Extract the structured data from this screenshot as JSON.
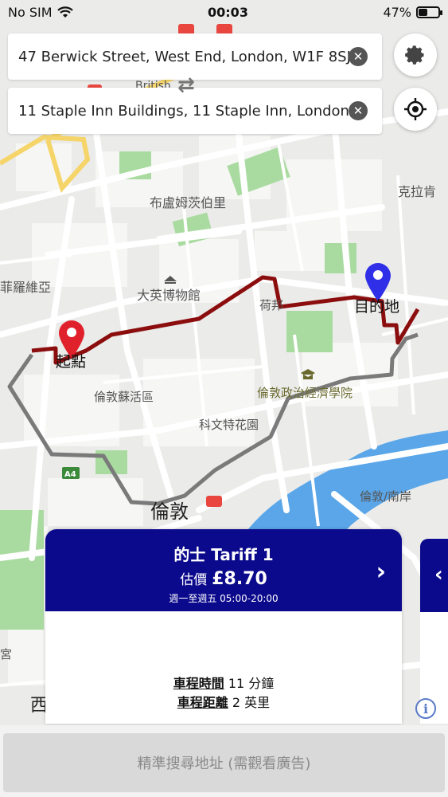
{
  "status_bar": {
    "carrier": "No SIM",
    "time": "00:03",
    "battery_percent": "47%",
    "battery_level": 0.47
  },
  "address": {
    "origin": "47 Berwick Street, West End, London, W1F 8SJ",
    "destination": "11 Staple Inn Buildings, 11 Staple Inn, London,"
  },
  "map": {
    "labels": {
      "british": "British",
      "bloomsbury": "布盧姆茨伯里",
      "clerkenwell": "克拉肯",
      "fitzrovia": "菲羅維亞",
      "museum": "大英博物館",
      "holborn": "荷邦",
      "start": "起點",
      "destination": "目的地",
      "soho": "倫敦蘇活區",
      "lse": "倫敦政治經濟學院",
      "covent_garden": "科文特花園",
      "london": "倫敦",
      "southwark": "倫敦/南岸",
      "road_a4": "A4",
      "palace": "宮",
      "west": "西"
    },
    "colors": {
      "driving_route": "#8b0d0d",
      "walking_route": "#7a7a7a",
      "start_pin": "#e0202b",
      "destination_pin": "#2f2fe8",
      "river": "#5aa6e8",
      "park": "#a9dba0"
    }
  },
  "fare_card": {
    "title": "的士 Tariff 1",
    "estimate_label": "估價",
    "price": "£8.70",
    "hours": "週一至週五 05:00-20:00",
    "duration_label": "車程時間",
    "duration_value": "11 分鐘",
    "distance_label": "車程距離",
    "distance_value": "2 英里"
  },
  "bottom": {
    "search_button": "精準搜尋地址 (需觀看廣告)"
  }
}
